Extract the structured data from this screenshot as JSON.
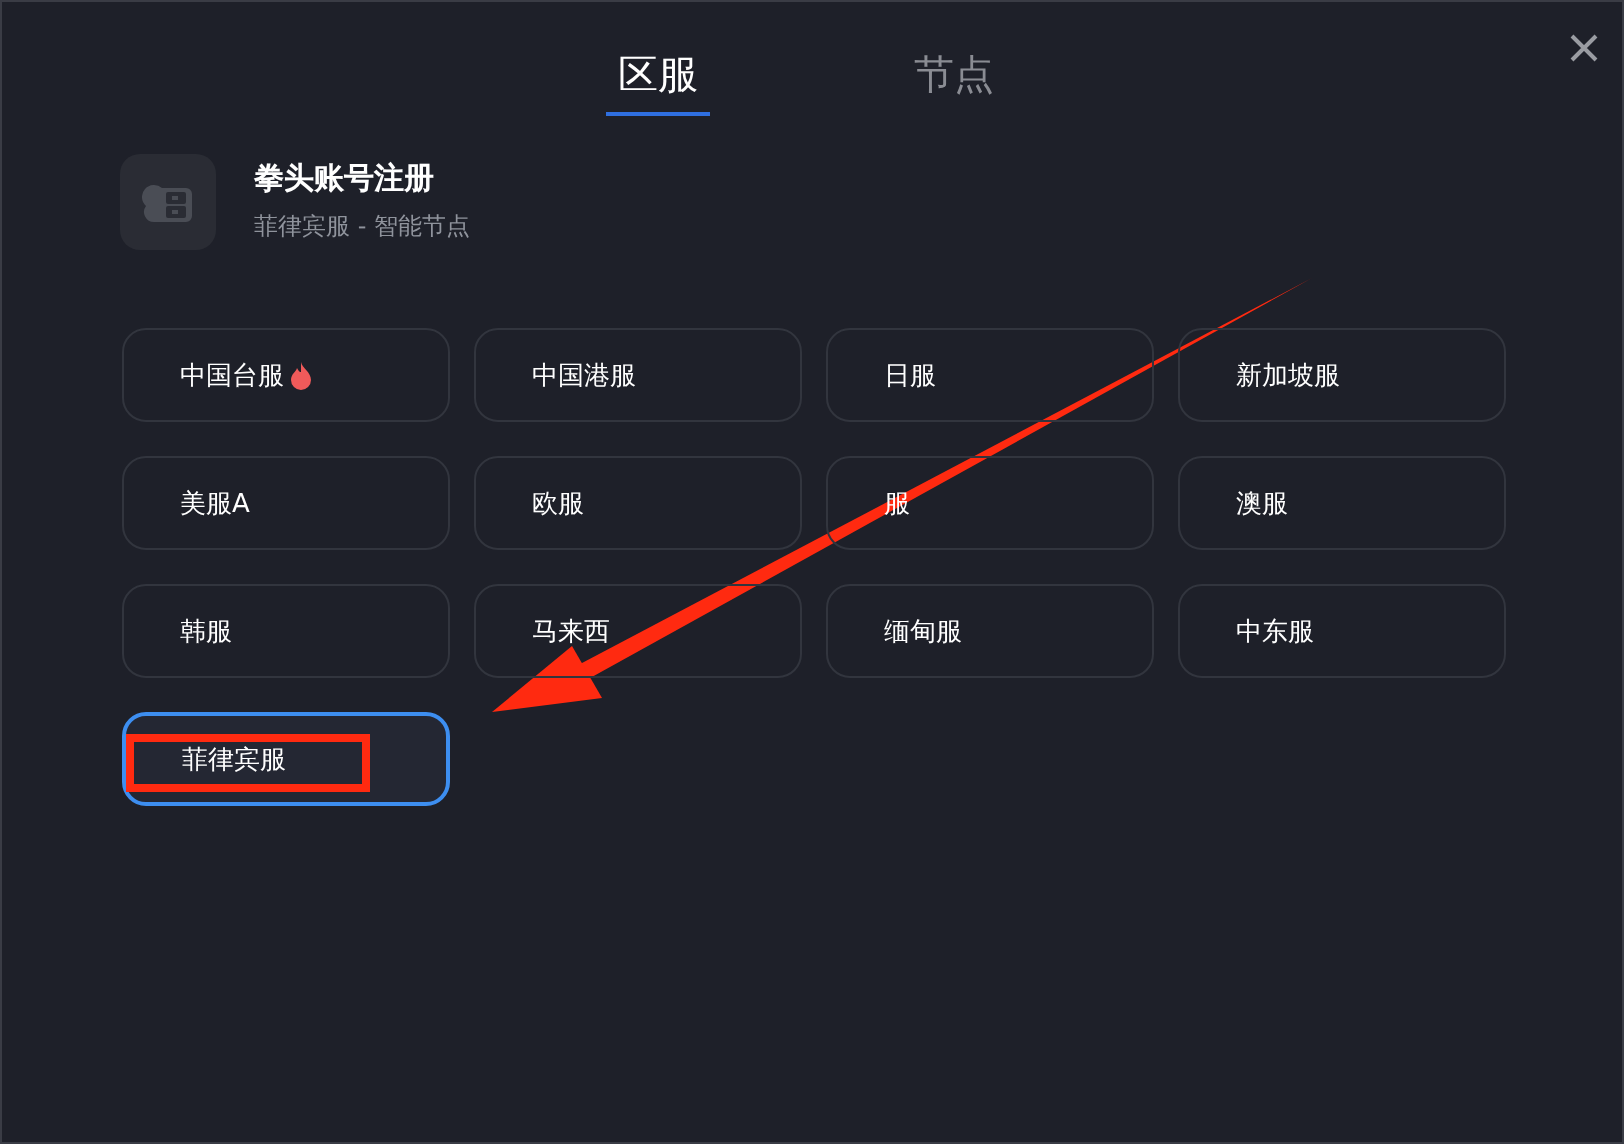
{
  "tabs": [
    {
      "label": "区服",
      "selected": true
    },
    {
      "label": "节点",
      "selected": false
    }
  ],
  "header": {
    "title": "拳头账号注册",
    "subtitle": "菲律宾服 - 智能节点"
  },
  "regions": [
    {
      "label": "中国台服",
      "hot": true,
      "selected": false
    },
    {
      "label": "中国港服",
      "hot": false,
      "selected": false
    },
    {
      "label": "日服",
      "hot": false,
      "selected": false
    },
    {
      "label": "新加坡服",
      "hot": false,
      "selected": false
    },
    {
      "label": "美服A",
      "hot": false,
      "selected": false
    },
    {
      "label": "欧服",
      "hot": false,
      "selected": false
    },
    {
      "label": "服",
      "hot": false,
      "selected": false
    },
    {
      "label": "澳服",
      "hot": false,
      "selected": false
    },
    {
      "label": "韩服",
      "hot": false,
      "selected": false
    },
    {
      "label": "马来西",
      "hot": false,
      "selected": false
    },
    {
      "label": "缅甸服",
      "hot": false,
      "selected": false
    },
    {
      "label": "中东服",
      "hot": false,
      "selected": false
    },
    {
      "label": "菲律宾服",
      "hot": false,
      "selected": true
    }
  ]
}
